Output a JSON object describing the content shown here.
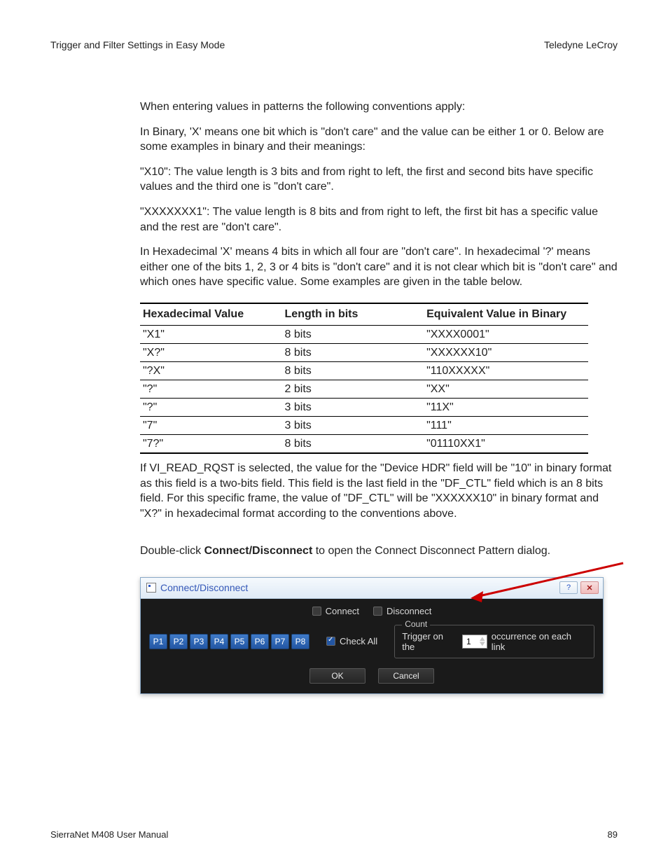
{
  "header": {
    "left": "Trigger and Filter Settings in Easy Mode",
    "right": "Teledyne LeCroy"
  },
  "paragraphs": {
    "p1": "When entering values in patterns the following conventions apply:",
    "p2": "In Binary, 'X' means one bit which is \"don't care\" and the value can be either 1 or 0. Below are some examples in binary and their meanings:",
    "p3": "\"X10\": The value length is 3 bits and from right to left, the first and second bits have specific values and the third one is \"don't care\".",
    "p4": "\"XXXXXXX1\": The value length is 8 bits and from right to left, the first bit has a specific value and the rest are \"don't care\".",
    "p5": "In Hexadecimal 'X' means 4 bits in which all four are \"don't care\". In hexadecimal '?' means either one of the bits 1, 2, 3 or 4 bits is \"don't care\" and it is not clear which bit is \"don't care\" and which ones have specific value. Some examples are given in the table below.",
    "p6": "If VI_READ_RQST is selected, the value for the \"Device HDR\" field will be \"10\" in binary format as this field is a two-bits field. This field is the last field in the \"DF_CTL\" field which is an 8 bits field. For this specific frame, the value of \"DF_CTL\" will be \"XXXXXX10\" in binary format and \"X?\" in hexadecimal format according to the conventions above.",
    "p7_pre": "Double-click ",
    "p7_strong": "Connect/Disconnect",
    "p7_post": " to open the Connect Disconnect Pattern dialog."
  },
  "table": {
    "headers": [
      "Hexadecimal Value",
      "Length in bits",
      "Equivalent Value in Binary"
    ],
    "rows": [
      [
        "\"X1\"",
        "8 bits",
        "\"XXXX0001\""
      ],
      [
        "\"X?\"",
        "8 bits",
        "\"XXXXXX10\""
      ],
      [
        "\"?X\"",
        "8 bits",
        "\"110XXXXX\""
      ],
      [
        "\"?\"",
        "2 bits",
        "\"XX\""
      ],
      [
        "\"?\"",
        "3 bits",
        "\"11X\""
      ],
      [
        "\"7\"",
        "3 bits",
        "\"111\""
      ],
      [
        "\"7?\"",
        "8 bits",
        "\"01110XX1\""
      ]
    ]
  },
  "dialog": {
    "title": "Connect/Disconnect",
    "help_glyph": "?",
    "close_glyph": "✕",
    "connect_label": "Connect",
    "disconnect_label": "Disconnect",
    "ports": [
      "P1",
      "P2",
      "P3",
      "P4",
      "P5",
      "P6",
      "P7",
      "P8"
    ],
    "check_all": "Check All",
    "count": {
      "legend": "Count",
      "pre": "Trigger on the",
      "value": "1",
      "post": "occurrence on each link"
    },
    "ok": "OK",
    "cancel": "Cancel"
  },
  "footer": {
    "left": "SierraNet M408 User Manual",
    "right": "89"
  }
}
